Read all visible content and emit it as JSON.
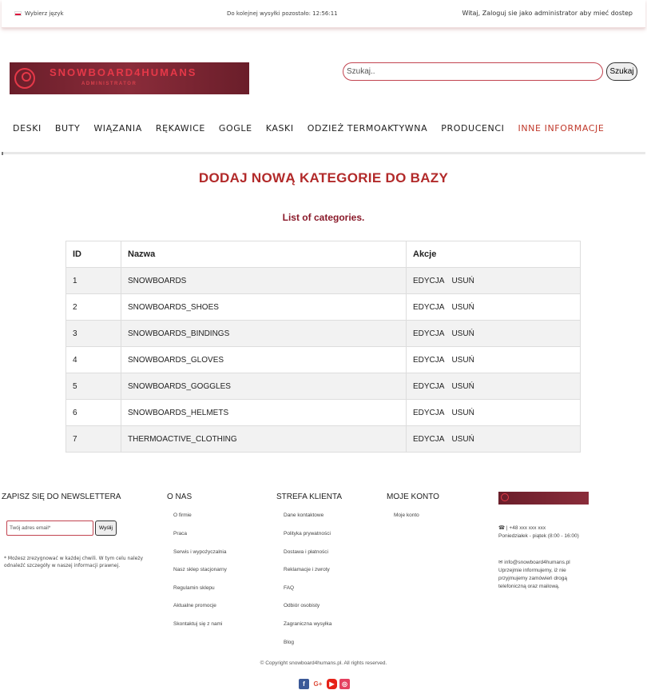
{
  "topbar": {
    "language": "Wybierz język",
    "shipping": "Do kolejnej wysyłki pozostało: 12:56:11",
    "welcome": "Witaj, Zaloguj sie jako administrator aby mieć dostep"
  },
  "header": {
    "logo_text": "SNOWBOARD4HUMANS",
    "logo_sub": "ADMINISTRATOR",
    "search_placeholder": "Szukaj..",
    "search_button": "Szukaj"
  },
  "nav": [
    {
      "label": "DESKI"
    },
    {
      "label": "BUTY"
    },
    {
      "label": "WIĄZANIA"
    },
    {
      "label": "RĘKAWICE"
    },
    {
      "label": "GOGLE"
    },
    {
      "label": "KASKI"
    },
    {
      "label": "ODZIEŻ TERMOAKTYWNA"
    },
    {
      "label": "PRODUCENCI"
    },
    {
      "label": "INNE INFORMACJE"
    }
  ],
  "main": {
    "title": "DODAJ NOWĄ KATEGORIE DO BAZY",
    "subtitle": "List of categories.",
    "columns": [
      "ID",
      "Nazwa",
      "Akcje"
    ],
    "rows": [
      {
        "id": "1",
        "name": "SNOWBOARDS"
      },
      {
        "id": "2",
        "name": "SNOWBOARDS_SHOES"
      },
      {
        "id": "3",
        "name": "SNOWBOARDS_BINDINGS"
      },
      {
        "id": "4",
        "name": "SNOWBOARDS_GLOVES"
      },
      {
        "id": "5",
        "name": "SNOWBOARDS_GOGGLES"
      },
      {
        "id": "6",
        "name": "SNOWBOARDS_HELMETS"
      },
      {
        "id": "7",
        "name": "THERMOACTIVE_CLOTHING"
      }
    ],
    "edit_label": "EDYCJA",
    "delete_label": "USUŃ"
  },
  "footer": {
    "newsletter_title": "ZAPISZ SIĘ DO NEWSLETTERA",
    "newsletter_placeholder": "Twój adres email*",
    "newsletter_button": "Wyślij",
    "newsletter_note": "* Możesz zrezygnować w każdej chwili. W tym celu należy odnaleźć szczegóły w naszej informacji prawnej.",
    "about_title": "O NAS",
    "about_links": [
      "O firmie",
      "Praca",
      "Serwis i wypożyczalnia",
      "Nasz sklep stacjonarny",
      "Regulamin sklepu",
      "Aktualne promocje",
      "Skontaktuj się z nami"
    ],
    "client_title": "STREFA KLIENTA",
    "client_links": [
      "Dane kontaktowe",
      "Polityka prywatności",
      "Dostawa i płatności",
      "Reklamacje i zwroty",
      "FAQ",
      "Odbiór osobisty",
      "Zagraniczna wysyłka",
      "Blog"
    ],
    "account_title": "MOJE KONTO",
    "account_links": [
      "Moje konto"
    ],
    "phone": "| +48 xxx xxx xxx",
    "hours": "Poniedziałek - piątek (8:00 - 16:00)",
    "email": "info@snowboard4humans.pl",
    "email_note": "Uprzejmie informujemy, iż nie przyjmujemy zamówień drogą telefoniczną oraz mailową.",
    "copyright": "© Copyright snowboard4humans.pl. All rights reserved."
  },
  "colors": {
    "accent": "#b22a2a",
    "nav_active": "#c0392b",
    "logo_bg": "#7a2433"
  }
}
